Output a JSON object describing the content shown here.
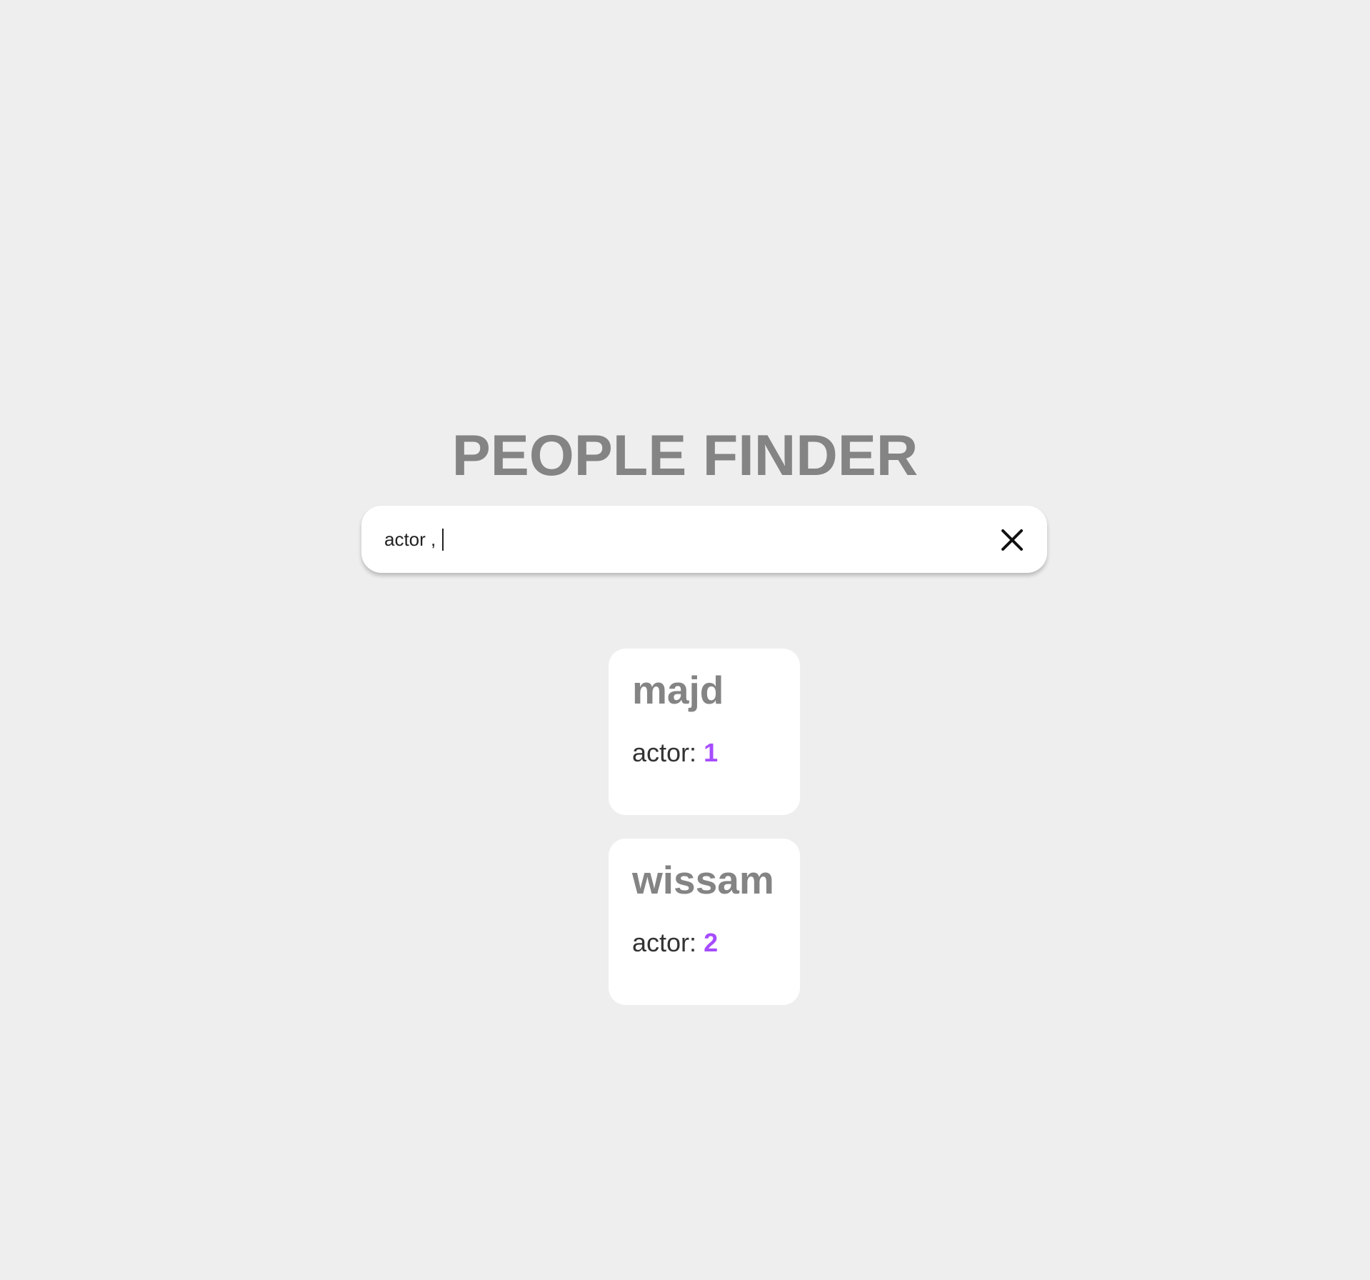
{
  "app": {
    "title": "PEOPLE FINDER"
  },
  "search": {
    "value": "actor ,",
    "clear_icon": "close-icon"
  },
  "results": [
    {
      "name": "majd",
      "role_label": "actor:",
      "role_value": "1"
    },
    {
      "name": "wissam",
      "role_label": "actor:",
      "role_value": "2"
    }
  ],
  "colors": {
    "background": "#eeeeee",
    "title": "#848484",
    "accent": "#a64cff",
    "card": "#ffffff"
  }
}
